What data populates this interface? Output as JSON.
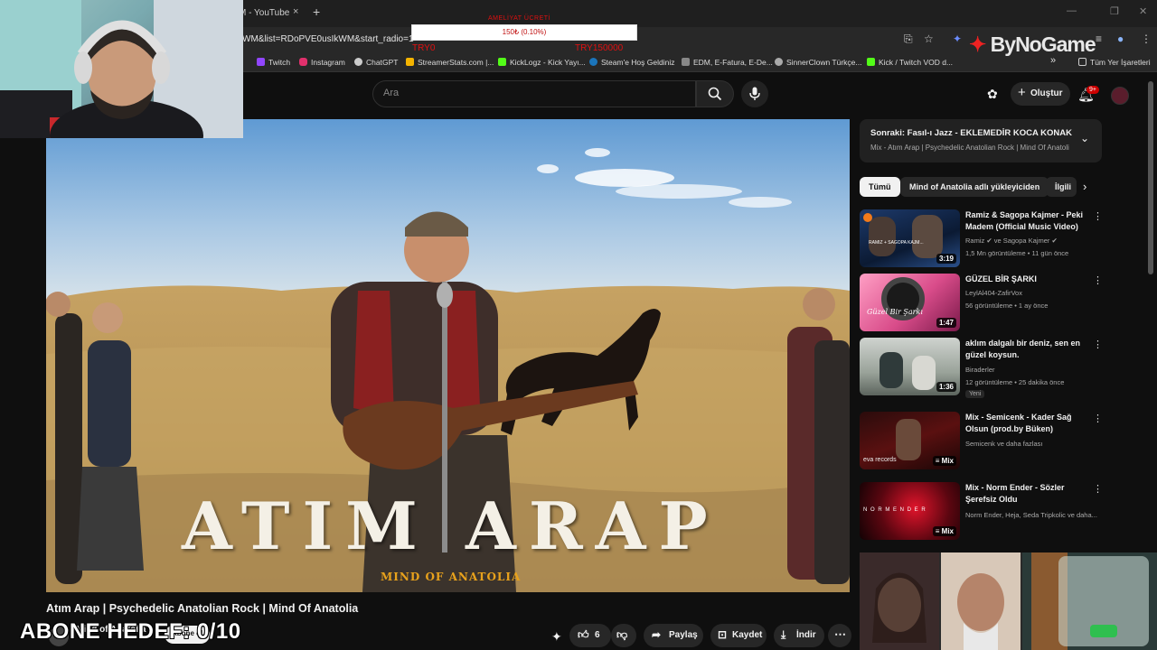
{
  "browser": {
    "tab_title": "M - YouTube",
    "tab_close": "×",
    "new_tab": "+",
    "url": "WM&list=RDoPVE0usIkWM&start_radio=1",
    "bookmarks": [
      "Twitch",
      "Instagram",
      "ChatGPT",
      "StreamerStats.com |...",
      "KickLogz - Kick Yayı...",
      "Steam'e Hoş Geldiniz",
      "EDM, E-Fatura, E-De...",
      "SinnerClown Türkçe...",
      "Kick / Twitch VOD d..."
    ],
    "bookmarks_more": "»",
    "all_bookmarks": "Tüm Yer İşaretleri"
  },
  "donation": {
    "title": "AMELİYAT ÜCRETİ",
    "progress_text": "150₺ (0.10%)",
    "progress_value": 0.001,
    "left_label": "TRY0",
    "right_label": "TRY150000"
  },
  "sponsor_logo": "ByNoGame",
  "youtube": {
    "search_placeholder": "Ara",
    "create_label": "Oluştur",
    "notif_count": "9+"
  },
  "video": {
    "title": "Atım Arap | Psychedelic Anatolian Rock | Mind Of Anatolia",
    "overlay_title": "ATIM ARAP",
    "overlay_brand": "MIND OF ANATOLIA",
    "channel": "Mind of Anatolia",
    "subscribe_label": "Abone ol",
    "like_count": "6",
    "share_label": "Paylaş",
    "save_label": "Kaydet",
    "download_label": "İndir"
  },
  "sidebar": {
    "next_label": "Sonraki: Fasıl-ı Jazz - EKLEMEDİR KOCA KONAK",
    "mix_label": "Mix - Atım Arap | Psychedelic Anatolian Rock | Mind Of Anatolia",
    "chips": [
      "Tümü",
      "Mind of Anatolia adlı yükleyiciden",
      "İlgili"
    ],
    "items": [
      {
        "title": "Ramiz & Sagopa Kajmer - Peki Madem (Official Music Video)",
        "channel": "Ramiz ✔ ve Sagopa Kajmer ✔",
        "meta": "1,5 Mn görüntüleme • 11 gün önce",
        "duration": "3:19",
        "thumb_text": "RAMIZ + SAGOPA KAJM..."
      },
      {
        "title": "GÜZEL BİR ŞARKI",
        "channel": "LeylAl404-ZafirVox",
        "meta": "56 görüntüleme • 1 ay önce",
        "duration": "1:47",
        "thumb_text": "Güzel Bir Şarkı"
      },
      {
        "title": "aklım dalgalı bir deniz, sen en güzel koysun.",
        "channel": "Biraderler",
        "meta": "12 görüntüleme • 25 dakika önce",
        "badge": "Yeni",
        "duration": "1:36"
      },
      {
        "title": "Mix - Semicenk - Kader Sağ Olsun (prod.by Büken)",
        "channel": "Semicenk ve daha fazlası",
        "meta": "",
        "duration": "Mix",
        "thumb_text": "eva records"
      },
      {
        "title": "Mix - Norm Ender - Sözler Şerefsiz Oldu",
        "channel": "Norm Ender, Heja, Seda Tripkolic ve daha...",
        "meta": "",
        "duration": "Mix",
        "thumb_text": "N O R M E N D E R"
      }
    ]
  },
  "stream_overlay": {
    "goal_text": "ABONE HEDEF: 0/10"
  },
  "colors": {
    "bg": "#0f0f0f",
    "accent_red": "#cc0000",
    "chip_bg": "#272727"
  }
}
